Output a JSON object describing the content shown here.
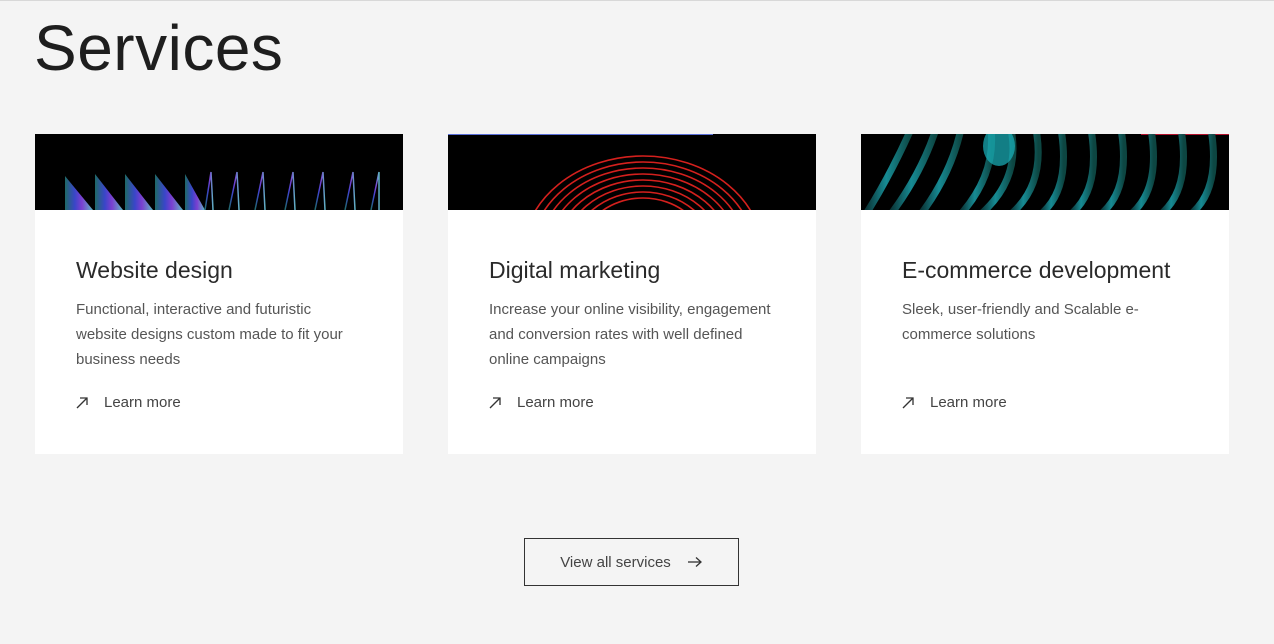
{
  "section": {
    "title": "Services"
  },
  "cards": [
    {
      "title": "Website design",
      "description": "Functional, interactive and futuristic website designs custom made to fit your business needs",
      "link_label": "Learn more",
      "banner_icon": "triangles-pattern"
    },
    {
      "title": "Digital marketing",
      "description": "Increase your online visibility, engagement and conversion rates with well defined online campaigns",
      "link_label": "Learn more",
      "banner_icon": "red-arcs-pattern"
    },
    {
      "title": "E-commerce development",
      "description": "Sleek, user-friendly and Scalable e-commerce solutions",
      "link_label": "Learn more",
      "banner_icon": "teal-waves-pattern"
    }
  ],
  "view_all": {
    "label": "View all services"
  },
  "colors": {
    "background": "#f4f4f4",
    "card": "#ffffff",
    "text": "#222222",
    "muted_text": "#555555",
    "banner_bg": "#000000",
    "accent_red": "#e0221f",
    "accent_teal": "#1aa3a8",
    "accent_purple": "#6a4bd8"
  }
}
